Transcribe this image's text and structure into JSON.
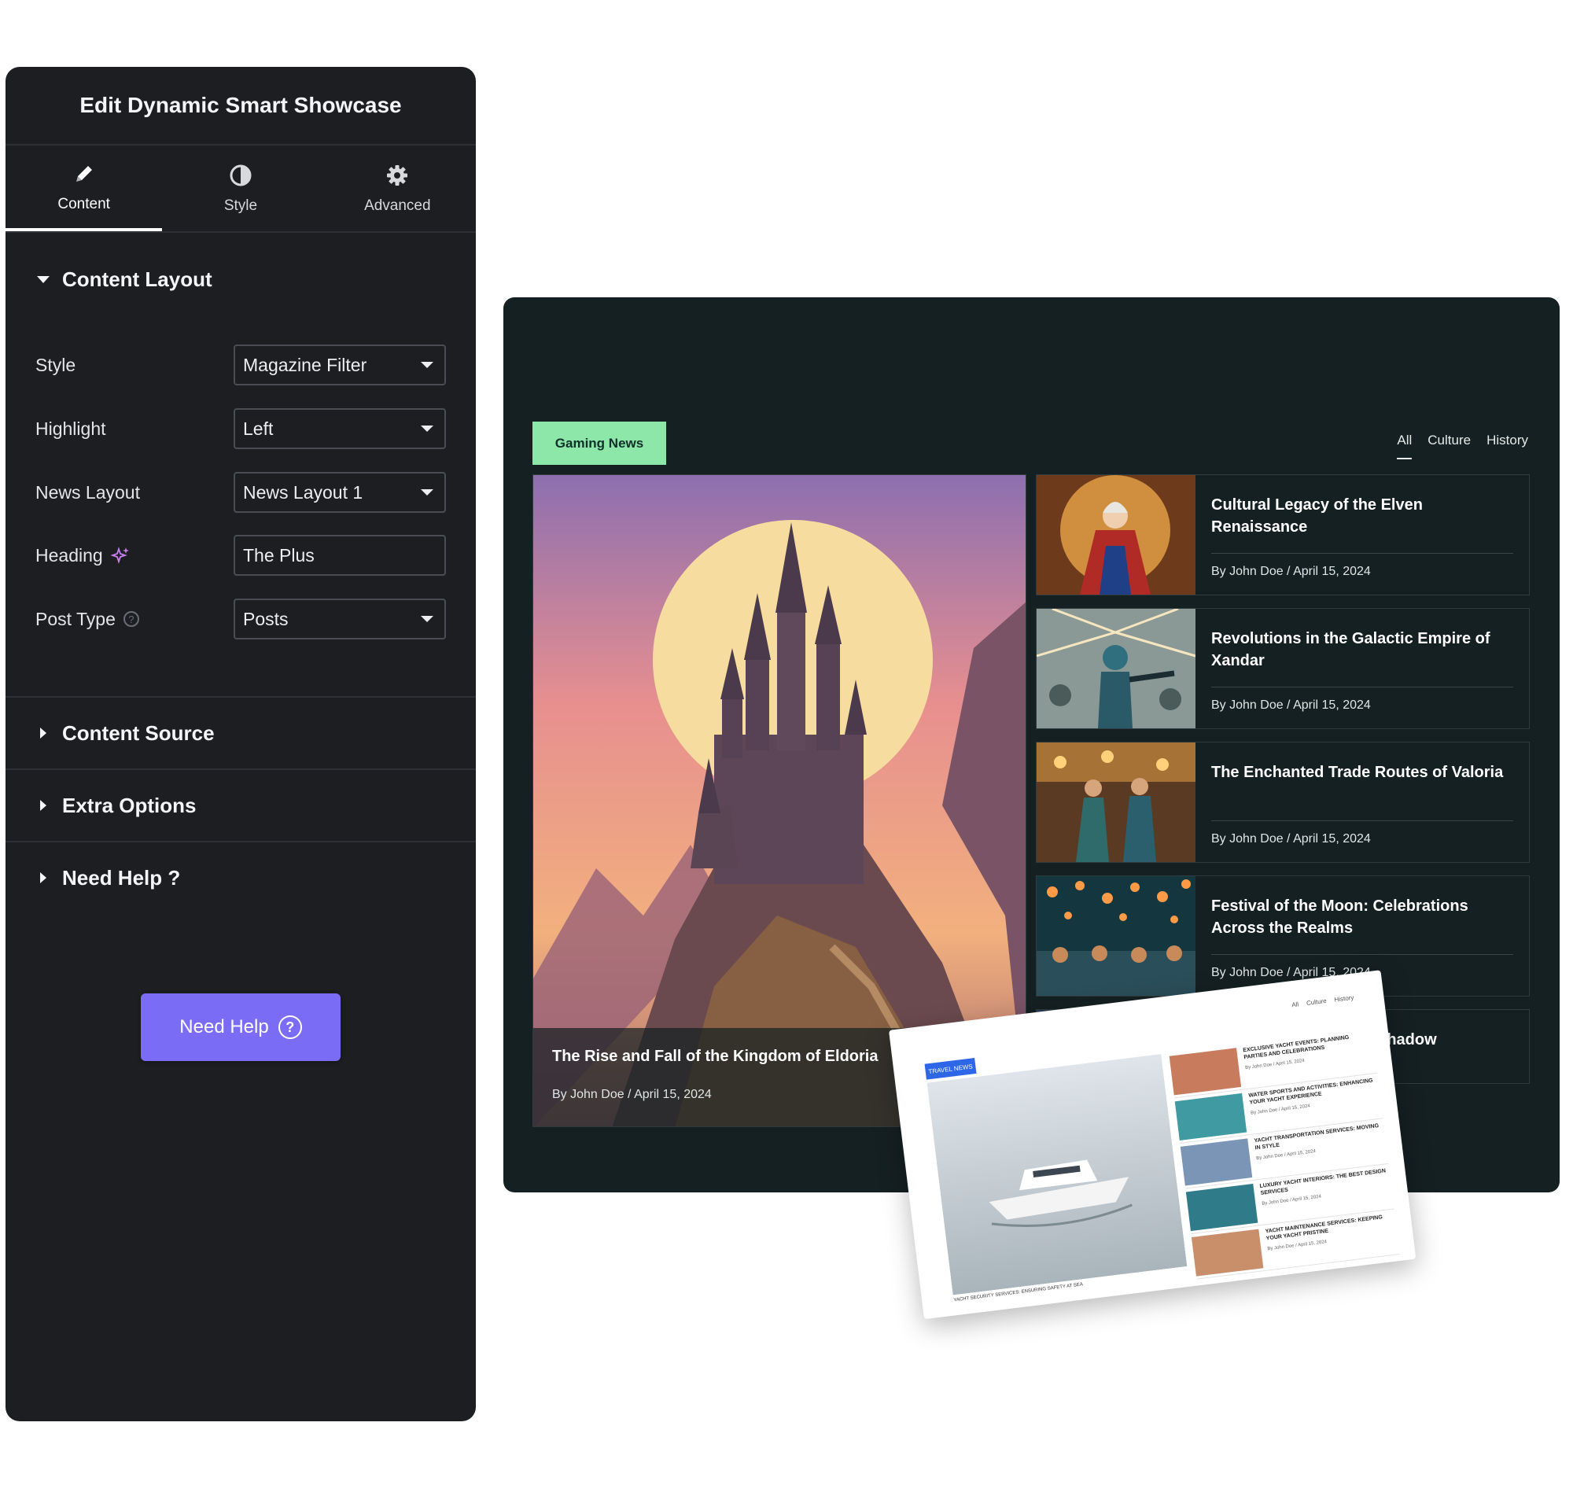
{
  "editor": {
    "title": "Edit Dynamic Smart Showcase",
    "tabs": [
      {
        "label": "Content",
        "icon": "pencil-icon",
        "active": true
      },
      {
        "label": "Style",
        "icon": "contrast-icon",
        "active": false
      },
      {
        "label": "Advanced",
        "icon": "gear-icon",
        "active": false
      }
    ],
    "content_layout": {
      "heading": "Content Layout",
      "fields": [
        {
          "label": "Style",
          "value": "Magazine Filter",
          "type": "select"
        },
        {
          "label": "Highlight",
          "value": "Left",
          "type": "select"
        },
        {
          "label": "News Layout",
          "value": "News Layout 1",
          "type": "select"
        },
        {
          "label": "Heading",
          "value": "The Plus",
          "type": "text"
        },
        {
          "label": "Post Type",
          "value": "Posts",
          "type": "select"
        }
      ]
    },
    "collapsed_sections": [
      "Content Source",
      "Extra Options",
      "Need Help ?"
    ],
    "help_button": "Need Help"
  },
  "showcase": {
    "badge": "Gaming News",
    "filters": [
      "All",
      "Culture",
      "History"
    ],
    "active_filter": "All",
    "accent_color": "#8de7a9",
    "hero": {
      "title": "The Rise and Fall of the Kingdom of Eldoria",
      "meta": "By John Doe / April 15, 2024"
    },
    "posts": [
      {
        "title": "Cultural Legacy of the Elven Renaissance",
        "meta": "By John Doe / April 15, 2024"
      },
      {
        "title": "Revolutions in the Galactic Empire of Xandar",
        "meta": "By John Doe / April 15, 2024"
      },
      {
        "title": "The Enchanted Trade Routes of Valoria",
        "meta": "By John Doe / April 15, 2024"
      },
      {
        "title": "Festival of the Moon: Celebrations Across the Realms",
        "meta": "By John Doe / April 15, 2024"
      },
      {
        "title": "Shadow",
        "meta": ""
      }
    ]
  },
  "mini_preview": {
    "badge": "TRAVEL NEWS",
    "filters": [
      "All",
      "Culture",
      "History"
    ],
    "hero_caption": "YACHT SECURITY SERVICES: ENSURING SAFETY AT SEA",
    "posts": [
      {
        "title": "EXCLUSIVE YACHT EVENTS: PLANNING PARTIES AND CELEBRATIONS",
        "meta": "By John Doe / April 15, 2024"
      },
      {
        "title": "WATER SPORTS AND ACTIVITIES: ENHANCING YOUR YACHT EXPERIENCE",
        "meta": "By John Doe / April 15, 2024"
      },
      {
        "title": "YACHT TRANSPORTATION SERVICES: MOVING IN STYLE",
        "meta": "By John Doe / April 15, 2024"
      },
      {
        "title": "LUXURY YACHT INTERIORS: THE BEST DESIGN SERVICES",
        "meta": "By John Doe / April 15, 2024"
      },
      {
        "title": "YACHT MAINTENANCE SERVICES: KEEPING YOUR YACHT PRISTINE",
        "meta": "By John Doe / April 15, 2024"
      }
    ]
  }
}
